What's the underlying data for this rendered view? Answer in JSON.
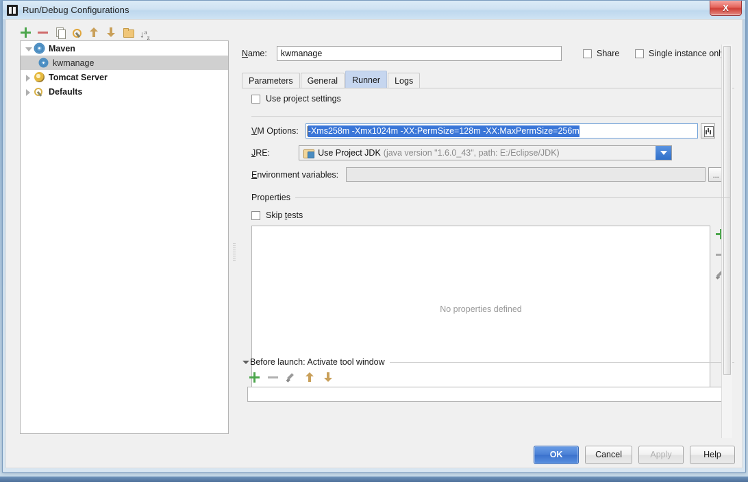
{
  "window": {
    "title": "Run/Debug Configurations",
    "app_icon": "intellij-idea-icon",
    "close_label": "X"
  },
  "tree_toolbar": {
    "items": [
      {
        "name": "add-configuration-button",
        "icon": "plus-icon",
        "tooltip": "Add New Configuration"
      },
      {
        "name": "remove-configuration-button",
        "icon": "minus-icon",
        "tooltip": "Remove Configuration"
      },
      {
        "name": "copy-configuration-button",
        "icon": "copy-icon",
        "tooltip": "Copy Configuration"
      },
      {
        "name": "edit-defaults-button",
        "icon": "wrench-icon",
        "tooltip": "Edit Defaults"
      },
      {
        "name": "move-up-button",
        "icon": "arrow-up-icon",
        "tooltip": "Move Up"
      },
      {
        "name": "move-down-button",
        "icon": "arrow-down-icon",
        "tooltip": "Move Down"
      },
      {
        "name": "create-folder-button",
        "icon": "folder-icon",
        "tooltip": "Create New Folder"
      },
      {
        "name": "sort-button",
        "icon": "sort-alphabetical-icon",
        "tooltip": "Sort Configurations"
      }
    ]
  },
  "tree": {
    "nodes": [
      {
        "label": "Maven",
        "icon": "maven-gear-icon",
        "expanded": true,
        "bold": true,
        "selected": false,
        "level": 0
      },
      {
        "label": "kwmanage",
        "icon": "maven-gear-icon",
        "expanded": null,
        "bold": false,
        "selected": true,
        "level": 1
      },
      {
        "label": "Tomcat Server",
        "icon": "tomcat-icon",
        "expanded": false,
        "bold": true,
        "selected": false,
        "level": 0
      },
      {
        "label": "Defaults",
        "icon": "defaults-wrench-icon",
        "expanded": false,
        "bold": true,
        "selected": false,
        "level": 0
      }
    ]
  },
  "form": {
    "name_label": "Name:",
    "name_value": "kwmanage",
    "share_label": "Share",
    "share_checked": false,
    "single_instance_label": "Single instance only",
    "single_instance_checked": false
  },
  "tabs": [
    {
      "label": "Parameters",
      "active": false
    },
    {
      "label": "General",
      "active": false
    },
    {
      "label": "Runner",
      "active": true
    },
    {
      "label": "Logs",
      "active": false
    }
  ],
  "runner": {
    "use_project_settings_label": "Use project settings",
    "use_project_settings_checked": false,
    "vm_options_label": "VM Options:",
    "vm_options_value": "-Xms258m -Xmx1024m -XX:PermSize=128m -XX:MaxPermSize=256m",
    "vm_options_selected": true,
    "vm_expand_icon": "expand-editor-icon",
    "jre_label": "JRE:",
    "jre_value_main": "Use Project JDK",
    "jre_value_detail": "(java version \"1.6.0_43\", path: E:/Eclipse/JDK)",
    "jre_icon": "jdk-folder-icon",
    "env_label": "Environment variables:",
    "env_value": "",
    "env_browse_label": "...",
    "properties_group_label": "Properties",
    "skip_tests_label": "Skip tests",
    "skip_tests_checked": false,
    "properties_empty_text": "No properties defined",
    "properties_side_buttons": [
      {
        "name": "add-property-button",
        "icon": "plus-icon"
      },
      {
        "name": "remove-property-button",
        "icon": "minus-icon"
      },
      {
        "name": "edit-property-button",
        "icon": "pencil-icon"
      }
    ]
  },
  "before_launch": {
    "title": "Before launch: Activate tool window",
    "expanded": true,
    "toolbar": [
      {
        "name": "before-launch-add-button",
        "icon": "plus-icon"
      },
      {
        "name": "before-launch-remove-button",
        "icon": "minus-icon"
      },
      {
        "name": "before-launch-edit-button",
        "icon": "pencil-icon"
      },
      {
        "name": "before-launch-move-up-button",
        "icon": "arrow-up-icon"
      },
      {
        "name": "before-launch-move-down-button",
        "icon": "arrow-down-icon"
      }
    ]
  },
  "buttons": {
    "ok": "OK",
    "cancel": "Cancel",
    "apply": "Apply",
    "apply_disabled": true,
    "help": "Help"
  },
  "colors": {
    "accent_blue": "#3a76d8",
    "primary_button": "#4a80d6",
    "tab_active": "#c6d6ef",
    "selection_bg": "#d0d0d0",
    "close_red": "#cf3f36"
  }
}
